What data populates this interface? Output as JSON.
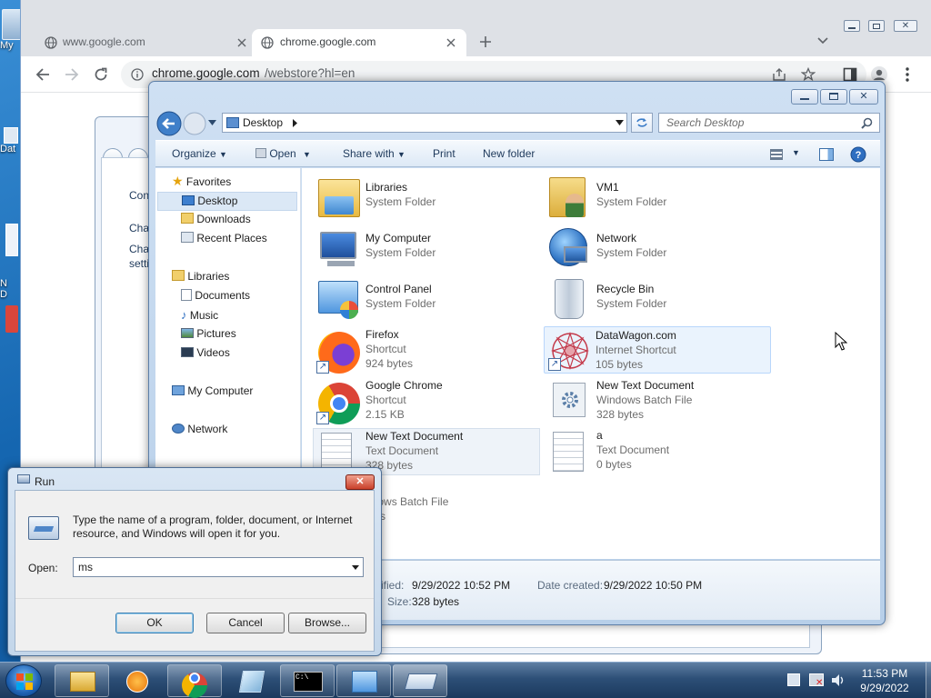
{
  "desktop": {
    "icons": [
      {
        "label": "My"
      },
      {
        "label": "Dat"
      },
      {
        "label": "N\nD"
      }
    ]
  },
  "chrome": {
    "tabs": [
      {
        "label": "www.google.com",
        "active": false
      },
      {
        "label": "chrome.google.com",
        "active": true
      }
    ],
    "url_host": "chrome.google.com",
    "url_path": "/webstore?hl=en"
  },
  "bg_dialog": {
    "lines": [
      "Con",
      "Cha",
      "Cha\nsetti"
    ]
  },
  "explorer": {
    "address_location": "Desktop",
    "search_placeholder": "Search Desktop",
    "commands": {
      "organize": "Organize",
      "open": "Open",
      "share_with": "Share with",
      "print": "Print",
      "new_folder": "New folder"
    },
    "nav": {
      "favorites": "Favorites",
      "favorites_items": [
        "Desktop",
        "Downloads",
        "Recent Places"
      ],
      "libraries": "Libraries",
      "libraries_items": [
        "Documents",
        "Music",
        "Pictures",
        "Videos"
      ],
      "my_computer": "My Computer",
      "network": "Network"
    },
    "files": [
      {
        "name": "Libraries",
        "type": "System Folder",
        "size": ""
      },
      {
        "name": "VM1",
        "type": "System Folder",
        "size": ""
      },
      {
        "name": "My Computer",
        "type": "System Folder",
        "size": ""
      },
      {
        "name": "Network",
        "type": "System Folder",
        "size": ""
      },
      {
        "name": "Control Panel",
        "type": "System Folder",
        "size": ""
      },
      {
        "name": "Recycle Bin",
        "type": "System Folder",
        "size": ""
      },
      {
        "name": "Firefox",
        "type": "Shortcut",
        "size": "924 bytes"
      },
      {
        "name": "DataWagon.com",
        "type": "Internet Shortcut",
        "size": "105 bytes"
      },
      {
        "name": "Google Chrome",
        "type": "Shortcut",
        "size": "2.15 KB"
      },
      {
        "name": "New Text Document",
        "type": "Windows Batch File",
        "size": "328 bytes"
      },
      {
        "name": "New Text Document",
        "type": "Text Document",
        "size": "328 bytes"
      },
      {
        "name": "a",
        "type": "Text Document",
        "size": "0 bytes"
      },
      {
        "name": "",
        "type": "ndows Batch File",
        "size": "ytes"
      }
    ],
    "details": {
      "modified_label": "ified:",
      "modified_value": "9/29/2022 10:52 PM",
      "created_label": "Date created:",
      "created_value": "9/29/2022 10:50 PM",
      "size_label": "Size:",
      "size_value": "328 bytes"
    }
  },
  "run": {
    "title": "Run",
    "description": "Type the name of a program, folder, document, or Internet resource, and Windows will open it for you.",
    "open_label": "Open:",
    "open_value": "ms",
    "ok": "OK",
    "cancel": "Cancel",
    "browse": "Browse..."
  },
  "taskbar": {
    "time": "11:53 PM",
    "date": "9/29/2022"
  }
}
